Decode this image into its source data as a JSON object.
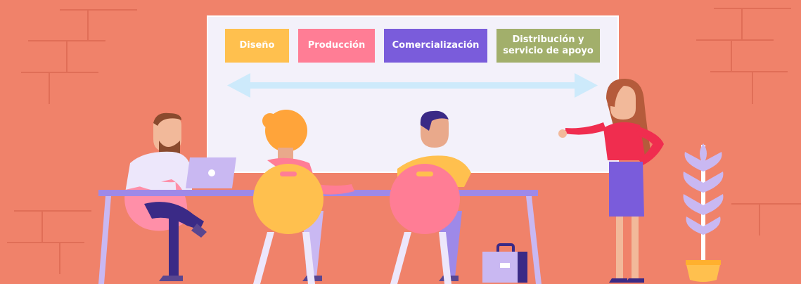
{
  "stages": [
    {
      "label": "Diseño",
      "color": "#FFC04E"
    },
    {
      "label": "Producción",
      "color": "#FF7D95"
    },
    {
      "label": "Comercialización",
      "color": "#7A5CDB"
    },
    {
      "label": "Distribución y servicio de apoyo",
      "color": "#A2AF6B"
    }
  ],
  "colors": {
    "background": "#F0826A",
    "brick_lines": "#E06E57",
    "board": "#F3F1FA",
    "arrow": "#CDEAFB",
    "table": "#9E89E8"
  }
}
